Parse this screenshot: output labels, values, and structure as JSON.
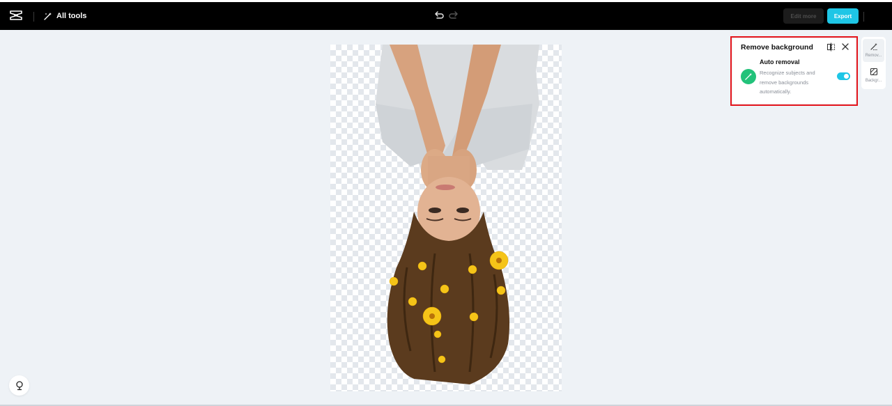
{
  "topbar": {
    "all_tools_label": "All tools",
    "edit_more_label": "Edit more",
    "export_label": "Export"
  },
  "icons": {
    "logo": "capcut-logo-icon",
    "all_tools": "magic-wand-icon",
    "undo": "undo-icon",
    "redo": "redo-icon",
    "compare": "compare-icon",
    "close": "close-icon",
    "auto_removal": "magic-wand-icon",
    "remove_tool": "remove-background-icon",
    "background_tool": "background-icon",
    "help": "lightbulb-icon"
  },
  "panel": {
    "title": "Remove background",
    "auto_removal": {
      "title": "Auto removal",
      "description": "Recognize subjects and remove backgrounds automatically.",
      "enabled": true
    }
  },
  "rail": {
    "items": [
      {
        "label": "Remov...",
        "active": true
      },
      {
        "label": "Backgr...",
        "active": false
      }
    ]
  },
  "colors": {
    "accent": "#1ec6e6",
    "highlight": "#e4141b",
    "auto_icon_bg": "#22c27a",
    "topbar_bg": "#000000",
    "workspace_bg": "#eef2f6"
  }
}
